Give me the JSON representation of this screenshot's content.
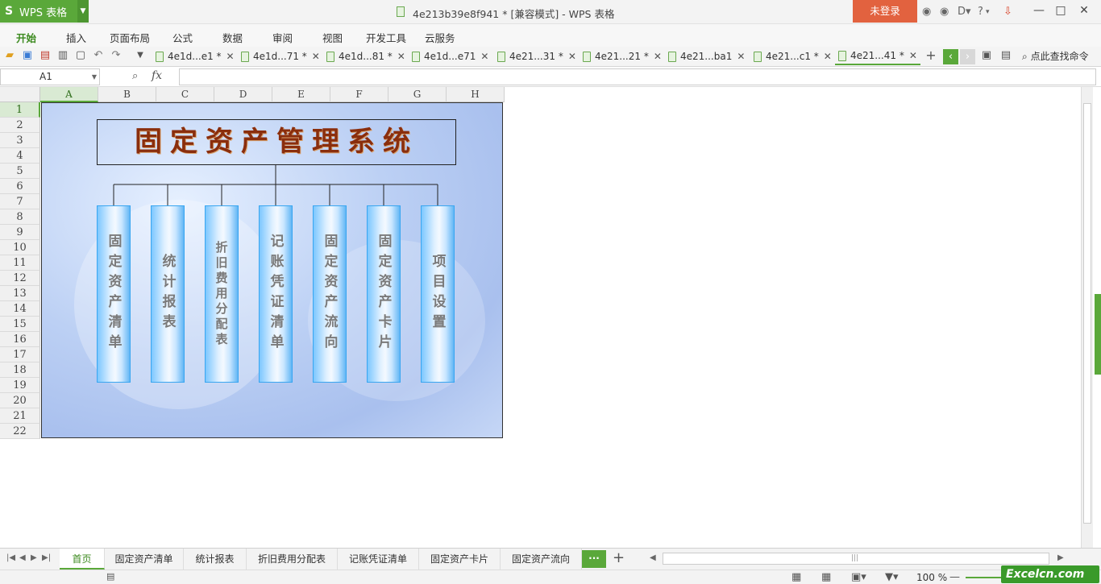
{
  "app": {
    "logo_text": "WPS 表格",
    "doc_title": "4e213b39e8f941 * [兼容模式] - WPS 表格",
    "login_label": "未登录",
    "help_label": "?",
    "accent": "#5aa83a",
    "login_color": "#e2623f"
  },
  "menu": [
    "开始",
    "插入",
    "页面布局",
    "公式",
    "数据",
    "审阅",
    "视图",
    "开发工具",
    "云服务"
  ],
  "doc_tabs": [
    "4e1d...e1 *",
    "4e1d...71 *",
    "4e1d...81 *",
    "4e1d...e71",
    "4e21...31 *",
    "4e21...21 *",
    "4e21...ba1",
    "4e21...c1 *",
    "4e21...41 *"
  ],
  "find_label": "点此查找命令",
  "formula": {
    "cell_ref": "A1",
    "fx_label": "fx",
    "value": ""
  },
  "columns": [
    "A",
    "B",
    "C",
    "D",
    "E",
    "F",
    "G",
    "H"
  ],
  "rows": [
    "1",
    "2",
    "3",
    "4",
    "5",
    "6",
    "7",
    "8",
    "9",
    "10",
    "11",
    "12",
    "13",
    "14",
    "15",
    "16",
    "17",
    "18",
    "19",
    "20",
    "21",
    "22"
  ],
  "panel": {
    "title": "固定资产管理系统",
    "modules": [
      "固定资产清单",
      "统计报表",
      "折旧费用分配表",
      "记账凭证清单",
      "固定资产流向",
      "固定资产卡片",
      "项目设置"
    ]
  },
  "sheets": [
    "首页",
    "固定资产清单",
    "统计报表",
    "折旧费用分配表",
    "记账凭证清单",
    "固定资产卡片",
    "固定资产流向"
  ],
  "more_label": "···",
  "status": {
    "zoom": "100 %"
  },
  "watermark": "Excelcn.com"
}
